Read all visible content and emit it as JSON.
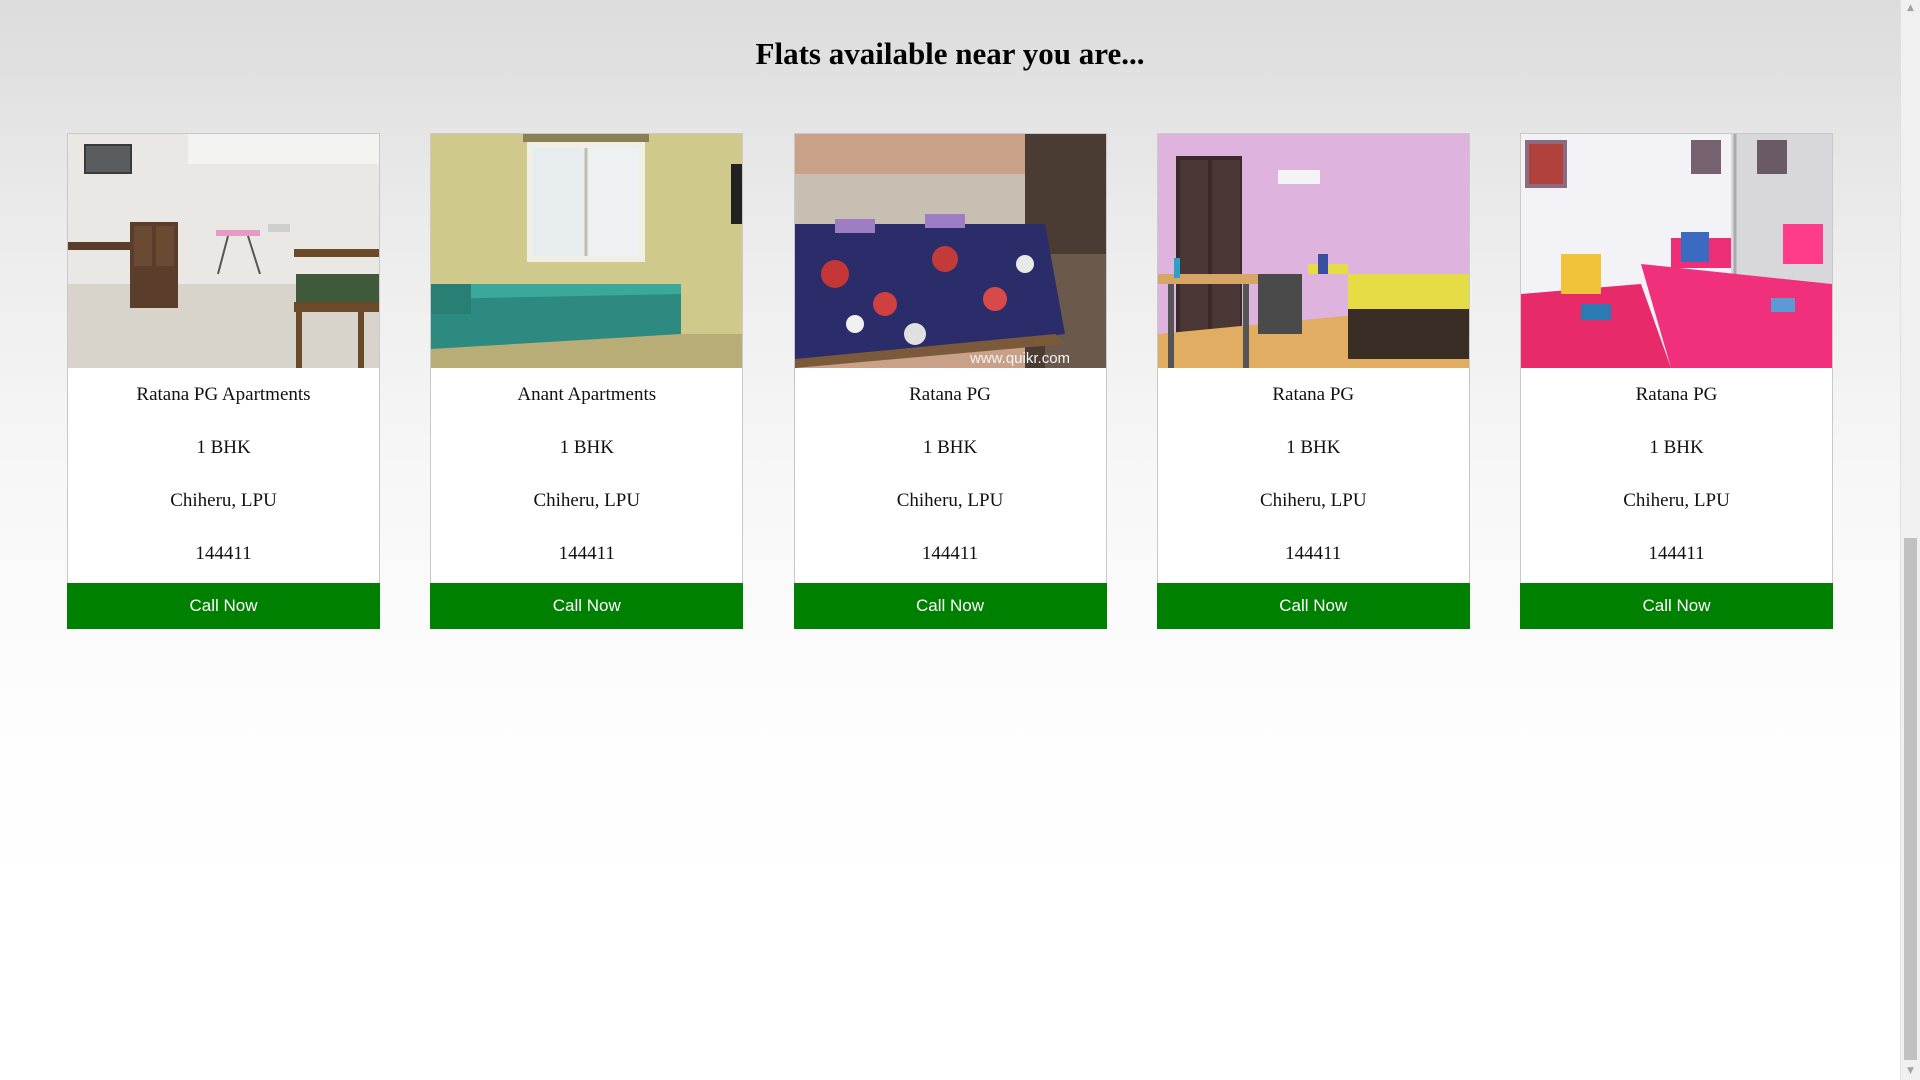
{
  "heading": "Flats available near you are...",
  "cards": [
    {
      "name": "Ratana PG Apartments",
      "type": "1 BHK",
      "location": "Chiheru, LPU",
      "pincode": "144411",
      "button": "Call Now"
    },
    {
      "name": "Anant Apartments",
      "type": "1 BHK",
      "location": "Chiheru, LPU",
      "pincode": "144411",
      "button": "Call Now"
    },
    {
      "name": "Ratana PG",
      "type": "1 BHK",
      "location": "Chiheru, LPU",
      "pincode": "144411",
      "button": "Call Now",
      "watermark": "www.quikr.com"
    },
    {
      "name": "Ratana PG",
      "type": "1 BHK",
      "location": "Chiheru, LPU",
      "pincode": "144411",
      "button": "Call Now"
    },
    {
      "name": "Ratana PG",
      "type": "1 BHK",
      "location": "Chiheru, LPU",
      "pincode": "144411",
      "button": "Call Now"
    }
  ],
  "colors": {
    "button": "#008000",
    "button_text": "#ffffff",
    "card_border": "#c9c9c9"
  },
  "icons": {
    "scroll_up": "scroll-up-arrow-icon",
    "scroll_down": "scroll-down-arrow-icon"
  }
}
